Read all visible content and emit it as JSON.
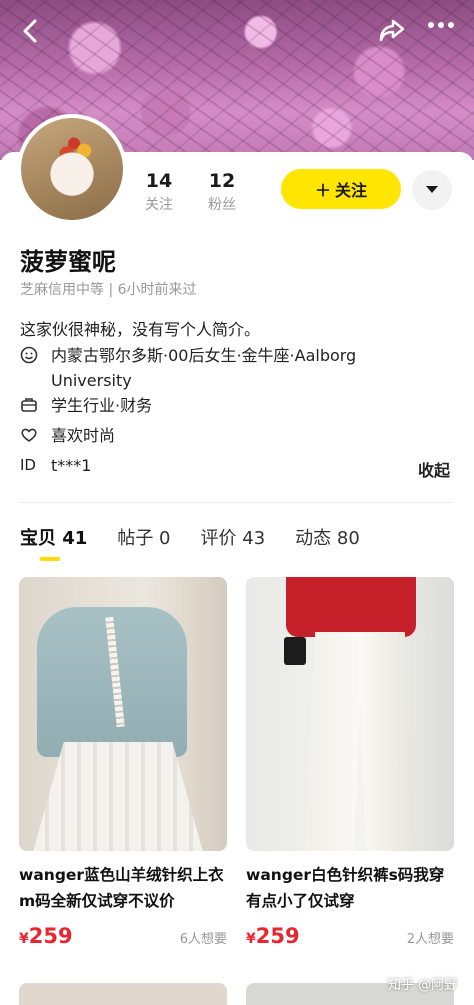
{
  "profile": {
    "following_count": "14",
    "following_label": "关注",
    "fans_count": "12",
    "fans_label": "粉丝",
    "follow_button": "关注",
    "name": "菠萝蜜呢",
    "credit_and_active": "芝麻信用中等 | 6小时前来过",
    "bio": "这家伙很神秘，没有写个人简介。",
    "location": "内蒙古鄂尔多斯·00后女生·金牛座·Aalborg University",
    "job": "学生行业·财务",
    "likes": "喜欢时尚",
    "id_label": "ID",
    "id_value": "t***1",
    "collapse": "收起"
  },
  "tabs": [
    {
      "label": "宝贝 41"
    },
    {
      "label": "帖子 0"
    },
    {
      "label": "评价 43"
    },
    {
      "label": "动态 80"
    }
  ],
  "products": [
    {
      "title": "wanger蓝色山羊绒针织上衣m码全新仅试穿不议价",
      "currency": "¥",
      "price": "259",
      "want": "6人想要"
    },
    {
      "title": "wanger白色针织裤s码我穿有点小了仅试穿",
      "currency": "¥",
      "price": "259",
      "want": "2人想要"
    }
  ],
  "watermark": "知乎 @阿野",
  "icons": {
    "back": "chevron-left-icon",
    "share": "share-icon",
    "more": "more-icon"
  },
  "colors": {
    "accent": "#ffe500",
    "price": "#e8262f"
  }
}
